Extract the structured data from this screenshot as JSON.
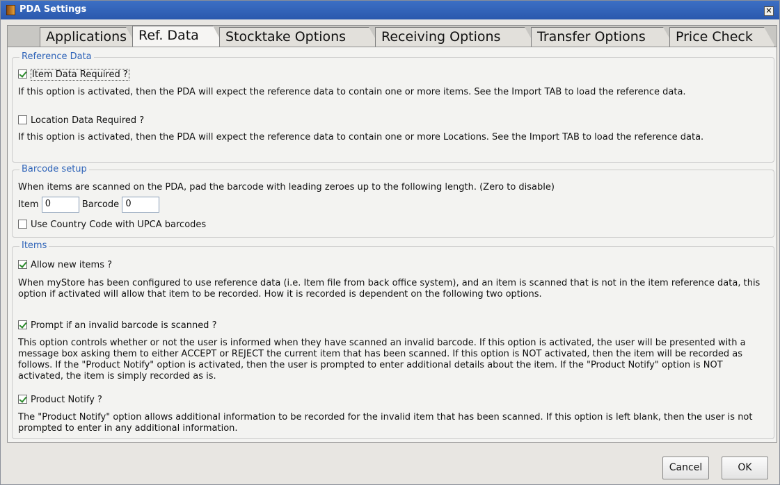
{
  "window": {
    "title": "PDA Settings",
    "close_glyph": "✕"
  },
  "tabs": [
    {
      "label": "Applications"
    },
    {
      "label": "Ref. Data"
    },
    {
      "label": "Stocktake Options"
    },
    {
      "label": "Receiving Options"
    },
    {
      "label": "Transfer Options"
    },
    {
      "label": "Price Check"
    }
  ],
  "active_tab": "Ref. Data",
  "reference_data": {
    "legend": "Reference Data",
    "item_data_required": {
      "label": "Item Data Required ?",
      "checked": true
    },
    "item_desc": "If this option is activated, then the PDA will expect the reference data to contain one or more items.  See the Import TAB to load the reference data.",
    "location_data_required": {
      "label": "Location Data Required ?",
      "checked": false
    },
    "location_desc": "If this option is activated, then the PDA will expect the reference data to contain one or more Locations.  See the Import TAB to load the reference data."
  },
  "barcode_setup": {
    "legend": "Barcode setup",
    "desc": "When items are scanned on the PDA, pad the barcode with leading zeroes up to the following length. (Zero to disable)",
    "item_label": "Item",
    "item_value": "0",
    "barcode_label": "Barcode",
    "barcode_value": "0",
    "country_code": {
      "label": "Use Country Code with UPCA barcodes",
      "checked": false
    }
  },
  "items": {
    "legend": "Items",
    "allow_new": {
      "label": "Allow new items ?",
      "checked": true
    },
    "allow_new_desc": "When myStore has been configured to use reference data (i.e. Item file from back office system), and an item is scanned that is not in the item reference data, this option if activated will allow that item to be recorded.  How it is recorded is dependent on the following two options.",
    "prompt_invalid": {
      "label": "Prompt if an invalid barcode is scanned ?",
      "checked": true
    },
    "prompt_invalid_desc": "This option controls whether or not the user is informed when they have scanned an invalid barcode.  If this option is activated, the user will be presented with a message box asking them to either ACCEPT or REJECT the current item that has been scanned.  If this option is NOT activated, then the item will be recorded as follows.  If the \"Product Notify\" option is activated, then the user is prompted to enter additional details about the item.  If the \"Product Notify\" option is NOT activated, the item is simply recorded as is.",
    "product_notify": {
      "label": "Product Notify ?",
      "checked": true
    },
    "product_notify_desc": "The \"Product Notify\" option allows additional information to be recorded for the invalid item that has been scanned.  If this option is left blank, then the user is not prompted to enter in any additional information."
  },
  "buttons": {
    "cancel": "Cancel",
    "ok": "OK"
  }
}
